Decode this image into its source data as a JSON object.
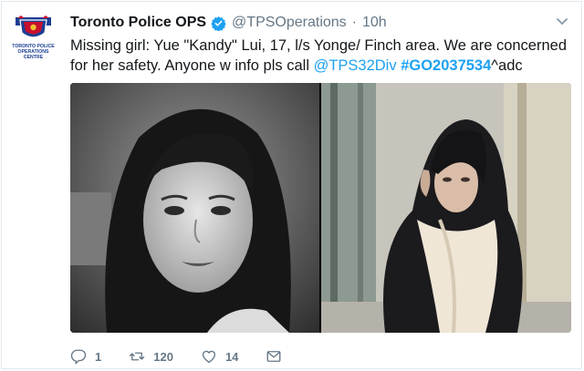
{
  "tweet": {
    "display_name": "Toronto Police OPS",
    "handle": "@TPSOperations",
    "separator": "·",
    "time": "10h",
    "avatar_text": "TORONTO POLICE OPERATIONS CENTRE",
    "text_part1": "Missing girl: Yue \"Kandy\" Lui, 17, l/s Yonge/ Finch area. We are concerned for her safety. Anyone w info pls call ",
    "mention": "@TPS32Div",
    "text_part2": " ",
    "hashtag": "#GO2037534",
    "text_part3": "^adc",
    "actions": {
      "replies": "1",
      "retweets": "120",
      "likes": "14"
    }
  },
  "colors": {
    "link": "#1da1f2",
    "muted": "#657786",
    "text": "#14171a",
    "avatar_blue": "#1b3e94",
    "avatar_red": "#c8102e"
  },
  "icons": [
    "toronto-police-crest-icon",
    "verified-badge-icon",
    "caret-down-icon",
    "reply-icon",
    "retweet-icon",
    "like-icon",
    "direct-message-icon"
  ]
}
